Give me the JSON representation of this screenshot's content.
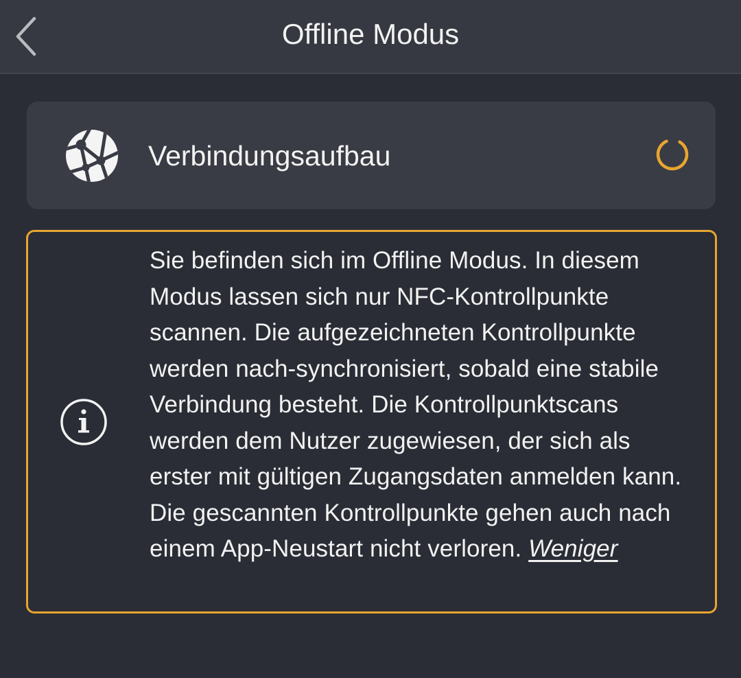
{
  "header": {
    "title": "Offline Modus",
    "back_icon": "chevron-left-icon"
  },
  "connection": {
    "icon": "globe-network-icon",
    "label": "Verbindungsaufbau",
    "status_icon": "loading-spinner-icon",
    "accent_color": "#e8a530"
  },
  "info": {
    "icon": "info-circle-icon",
    "text": "Sie befinden sich im Offline Modus. In diesem Modus lassen sich nur NFC-Kontrollpunkte scannen. Die aufgezeichneten Kontrollpunkte werden nach-synchronisiert, sobald eine stabile Verbindung besteht. Die Kontrollpunktscans werden dem Nutzer zugewiesen, der sich als erster mit gültigen Zugangsdaten anmelden kann. Die gescannten Kontrollpunkte gehen auch nach einem App-Neustart nicht verloren.",
    "less_link": "Weniger",
    "border_color": "#e8a530"
  }
}
